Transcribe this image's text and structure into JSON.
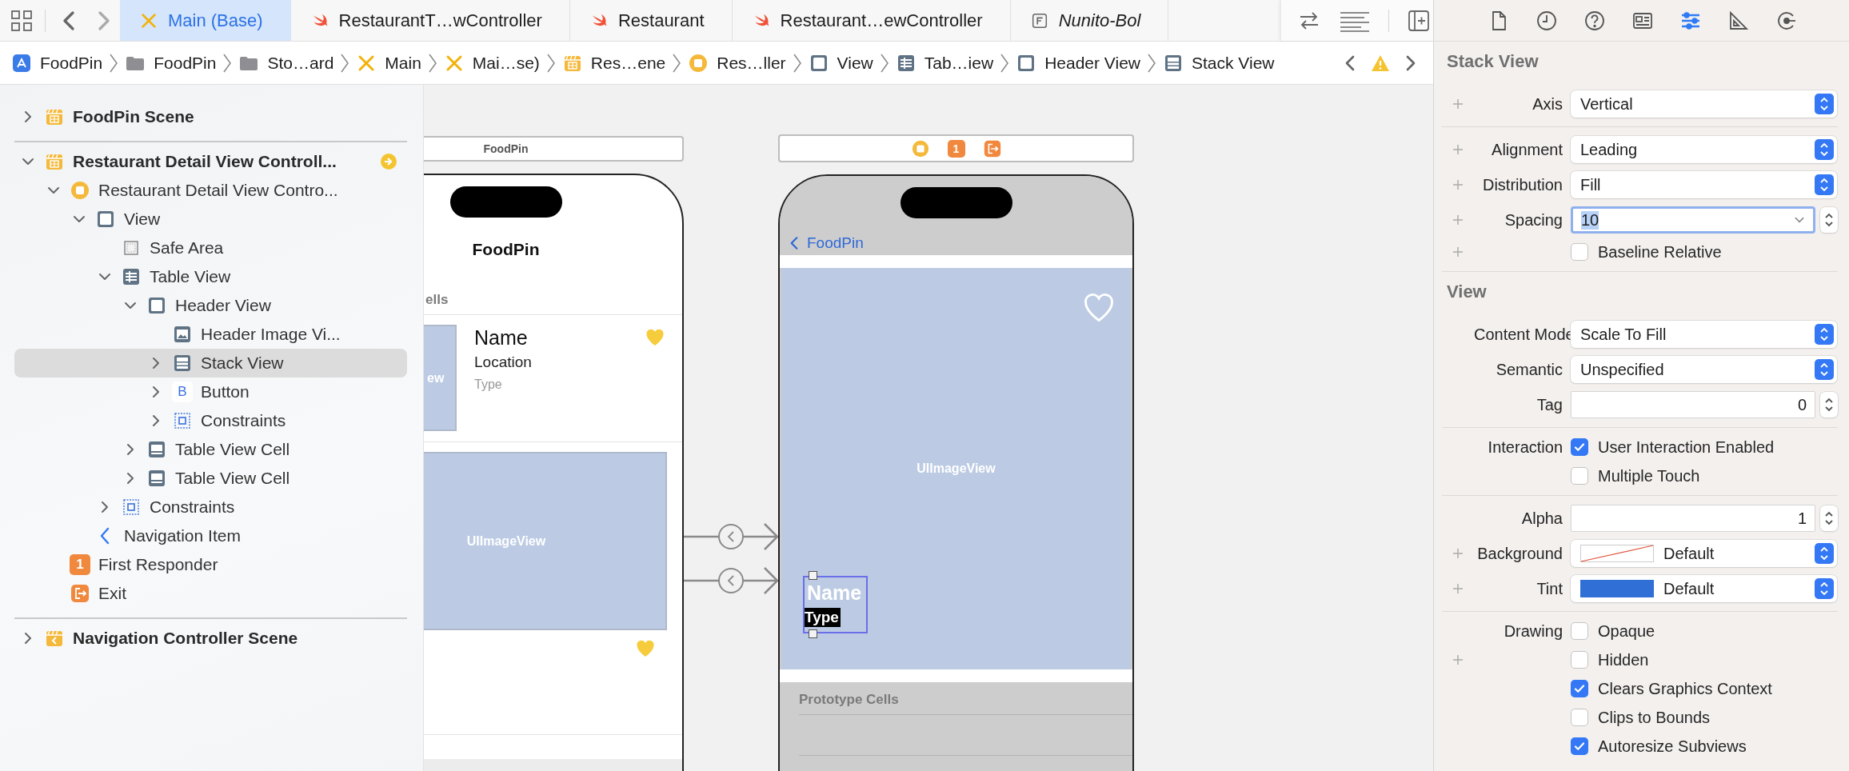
{
  "tab_bar": {
    "tabs": [
      {
        "label": "Main (Base)",
        "kind": "storyboard",
        "selected": true,
        "italic": false
      },
      {
        "label": "RestaurantT…wController",
        "kind": "swift",
        "selected": false,
        "italic": false
      },
      {
        "label": "Restaurant",
        "kind": "swift",
        "selected": false,
        "italic": false
      },
      {
        "label": "Restaurant…ewController",
        "kind": "swift",
        "selected": false,
        "italic": false
      },
      {
        "label": "Nunito-Bol",
        "kind": "font",
        "selected": false,
        "italic": true
      }
    ]
  },
  "breadcrumb": {
    "items": [
      {
        "label": "FoodPin",
        "kind": "app"
      },
      {
        "label": "FoodPin",
        "kind": "folder"
      },
      {
        "label": "Sto…ard",
        "kind": "folder"
      },
      {
        "label": "Main",
        "kind": "storyboard"
      },
      {
        "label": "Mai…se)",
        "kind": "storyboard"
      },
      {
        "label": "Res…ene",
        "kind": "scene"
      },
      {
        "label": "Res…ller",
        "kind": "controller"
      },
      {
        "label": "View",
        "kind": "view"
      },
      {
        "label": "Tab…iew",
        "kind": "table"
      },
      {
        "label": "Header View",
        "kind": "view"
      },
      {
        "label": "Stack View",
        "kind": "stack"
      }
    ]
  },
  "outline": {
    "items": [
      {
        "label": "FoodPin Scene",
        "kind": "scene",
        "expanded": false,
        "selected": false,
        "entry_point": false
      },
      {
        "label": "Restaurant Detail View Controll...",
        "kind": "scene",
        "expanded": true,
        "selected": false,
        "entry_point": true,
        "children": [
          {
            "label": "Restaurant Detail View Contro...",
            "kind": "controller",
            "expanded": true,
            "selected": false,
            "children": [
              {
                "label": "View",
                "kind": "view",
                "expanded": true,
                "selected": false,
                "children": [
                  {
                    "label": "Safe Area",
                    "kind": "safearea",
                    "selected": false
                  },
                  {
                    "label": "Table View",
                    "kind": "table",
                    "expanded": true,
                    "selected": false,
                    "children": [
                      {
                        "label": "Header View",
                        "kind": "view",
                        "expanded": true,
                        "selected": false,
                        "children": [
                          {
                            "label": "Header Image Vi...",
                            "kind": "imageview",
                            "selected": false
                          },
                          {
                            "label": "Stack View",
                            "kind": "stack",
                            "expanded": false,
                            "selected": true
                          },
                          {
                            "label": "Button",
                            "kind": "button",
                            "glyph": "B",
                            "expanded": false,
                            "selected": false
                          },
                          {
                            "label": "Constraints",
                            "kind": "constraints",
                            "expanded": false,
                            "selected": false
                          }
                        ]
                      },
                      {
                        "label": "Table View Cell",
                        "kind": "cell",
                        "expanded": false,
                        "selected": false
                      },
                      {
                        "label": "Table View Cell",
                        "kind": "cell",
                        "expanded": false,
                        "selected": false
                      }
                    ]
                  },
                  {
                    "label": "Constraints",
                    "kind": "constraints",
                    "expanded": false,
                    "selected": false
                  }
                ]
              },
              {
                "label": "Navigation Item",
                "kind": "back",
                "selected": false
              }
            ]
          },
          {
            "label": "First Responder",
            "kind": "responder",
            "glyph": "1",
            "selected": false
          },
          {
            "label": "Exit",
            "kind": "exit",
            "selected": false
          }
        ]
      },
      {
        "label": "Navigation Controller Scene",
        "kind": "navscene",
        "expanded": false,
        "selected": false,
        "entry_point": false
      }
    ]
  },
  "canvas": {
    "scenes": [
      {
        "kind": "list",
        "title": "FoodPin",
        "nav_title": "FoodPin",
        "section_header": "ells",
        "cells": [
          {
            "kind": "row",
            "image_label": "ew",
            "name": "Name",
            "location": "Location",
            "type": "Type",
            "favorite": true
          },
          {
            "kind": "image",
            "image_label": "UIImageView",
            "favorite": true
          }
        ]
      },
      {
        "kind": "detail",
        "dock": [
          {
            "kind": "controller"
          },
          {
            "kind": "responder",
            "glyph": "1"
          },
          {
            "kind": "exit"
          }
        ],
        "back_label": "FoodPin",
        "image_label": "UIImageView",
        "favorite": false,
        "stack_name": "Name",
        "stack_type": "Type",
        "section_header": "Prototype Cells"
      }
    ]
  },
  "inspector": {
    "tabs": [
      {
        "kind": "file",
        "selected": false
      },
      {
        "kind": "history",
        "selected": false
      },
      {
        "kind": "help",
        "selected": false
      },
      {
        "kind": "identity",
        "selected": false
      },
      {
        "kind": "attributes",
        "selected": true
      },
      {
        "kind": "size",
        "selected": false
      },
      {
        "kind": "connections",
        "selected": false
      }
    ],
    "sections": [
      {
        "title": "Stack View",
        "groups": [
          {
            "rows": [
              {
                "kind": "popup",
                "label": "Axis",
                "value": "Vertical",
                "plus": true
              }
            ]
          },
          {
            "rows": [
              {
                "kind": "popup",
                "label": "Alignment",
                "value": "Leading",
                "plus": true
              },
              {
                "kind": "popup",
                "label": "Distribution",
                "value": "Fill",
                "plus": true
              },
              {
                "kind": "combo",
                "label": "Spacing",
                "value": "10",
                "plus": true,
                "focused": true
              },
              {
                "kind": "checkbox",
                "option": "Baseline Relative",
                "checked": false,
                "plus": true
              }
            ]
          }
        ]
      },
      {
        "title": "View",
        "groups": [
          {
            "rows": [
              {
                "kind": "popup",
                "label": "Content Mode",
                "value": "Scale To Fill",
                "plus": false
              },
              {
                "kind": "popup",
                "label": "Semantic",
                "value": "Unspecified",
                "plus": false
              },
              {
                "kind": "number",
                "label": "Tag",
                "value": "0",
                "plus": false
              }
            ]
          },
          {
            "rows": [
              {
                "kind": "checkbox",
                "label": "Interaction",
                "option": "User Interaction Enabled",
                "checked": true,
                "plus": false
              },
              {
                "kind": "checkbox",
                "option": "Multiple Touch",
                "checked": false,
                "plus": false
              }
            ]
          },
          {
            "rows": [
              {
                "kind": "number",
                "label": "Alpha",
                "value": "1",
                "plus": false
              },
              {
                "kind": "no_color",
                "label": "Background",
                "value": "Default",
                "plus": true
              },
              {
                "kind": "color",
                "label": "Tint",
                "value": "Default",
                "color": "#2f6fd6",
                "plus": true
              }
            ]
          },
          {
            "rows": [
              {
                "kind": "checkbox",
                "label": "Drawing",
                "option": "Opaque",
                "checked": false,
                "plus": false
              },
              {
                "kind": "checkbox",
                "option": "Hidden",
                "checked": false,
                "plus": true
              },
              {
                "kind": "checkbox",
                "option": "Clears Graphics Context",
                "checked": true,
                "plus": false
              },
              {
                "kind": "checkbox",
                "option": "Clips to Bounds",
                "checked": false,
                "plus": false
              },
              {
                "kind": "checkbox",
                "option": "Autoresize Subviews",
                "checked": true,
                "plus": false
              }
            ]
          }
        ]
      }
    ]
  }
}
